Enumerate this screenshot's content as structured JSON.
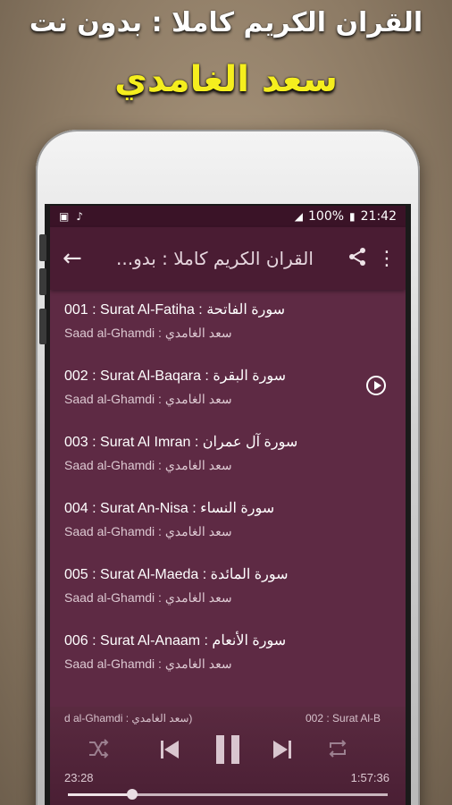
{
  "promo": {
    "line1": "القران الكريم كاملا : بدون نت",
    "line2": "سعد الغامدي"
  },
  "statusbar": {
    "battery": "100%",
    "time": "21:42"
  },
  "appbar": {
    "title": "القران الكريم كاملا : بدو..."
  },
  "surahs": [
    {
      "title": "001 : Surat Al-Fatiha : سورة الفاتحة",
      "reciter": "Saad al-Ghamdi : سعد الغامدي",
      "playing": false
    },
    {
      "title": "002 : Surat Al-Baqara : سورة البقرة",
      "reciter": "Saad al-Ghamdi : سعد الغامدي",
      "playing": true
    },
    {
      "title": "003 : Surat Al Imran : سورة آل عمران",
      "reciter": "Saad al-Ghamdi : سعد الغامدي",
      "playing": false
    },
    {
      "title": "004 : Surat An-Nisa : سورة النساء",
      "reciter": "Saad al-Ghamdi : سعد الغامدي",
      "playing": false
    },
    {
      "title": "005 : Surat Al-Maeda : سورة المائدة",
      "reciter": "Saad al-Ghamdi : سعد الغامدي",
      "playing": false
    },
    {
      "title": "006 :  Surat Al-Anaam : سورة الأنعام",
      "reciter": "Saad al-Ghamdi : سعد الغامدي",
      "playing": false
    }
  ],
  "player": {
    "now_reciter": "d al-Ghamdi : سعد الغامدي)",
    "now_title": "002 : Surat Al-B",
    "elapsed": "23:28",
    "total": "1:57:36",
    "progress": 0.2
  },
  "colors": {
    "screen_bg": "#5e2a44",
    "appbar_bg": "#4a1c33",
    "statusbar_bg": "#3a1327",
    "promo_accent": "#f5ee1e"
  }
}
